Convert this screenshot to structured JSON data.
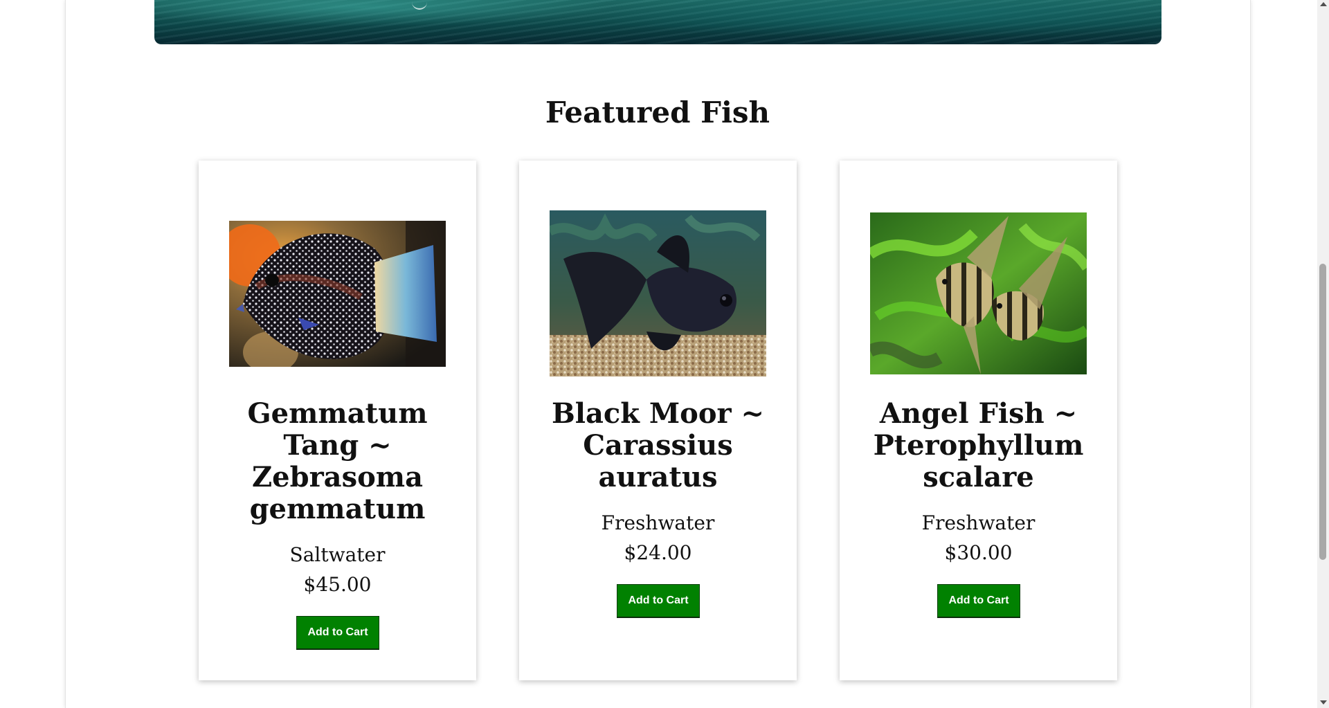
{
  "section": {
    "title": "Featured Fish"
  },
  "products": [
    {
      "name": "Gemmatum Tang ~ Zebrasoma gemmatum",
      "type": "Saltwater",
      "price": "$45.00",
      "button": "Add to Cart"
    },
    {
      "name": "Black Moor ~ Carassius auratus",
      "type": "Freshwater",
      "price": "$24.00",
      "button": "Add to Cart"
    },
    {
      "name": "Angel Fish ~ Pterophyllum scalare",
      "type": "Freshwater",
      "price": "$30.00",
      "button": "Add to Cart"
    }
  ],
  "colors": {
    "button_bg": "#018101",
    "button_text": "#ffffff",
    "hero_water": "#0d4a4c"
  },
  "icons": [
    "scroll-up-arrow-icon",
    "scroll-down-arrow-icon"
  ]
}
